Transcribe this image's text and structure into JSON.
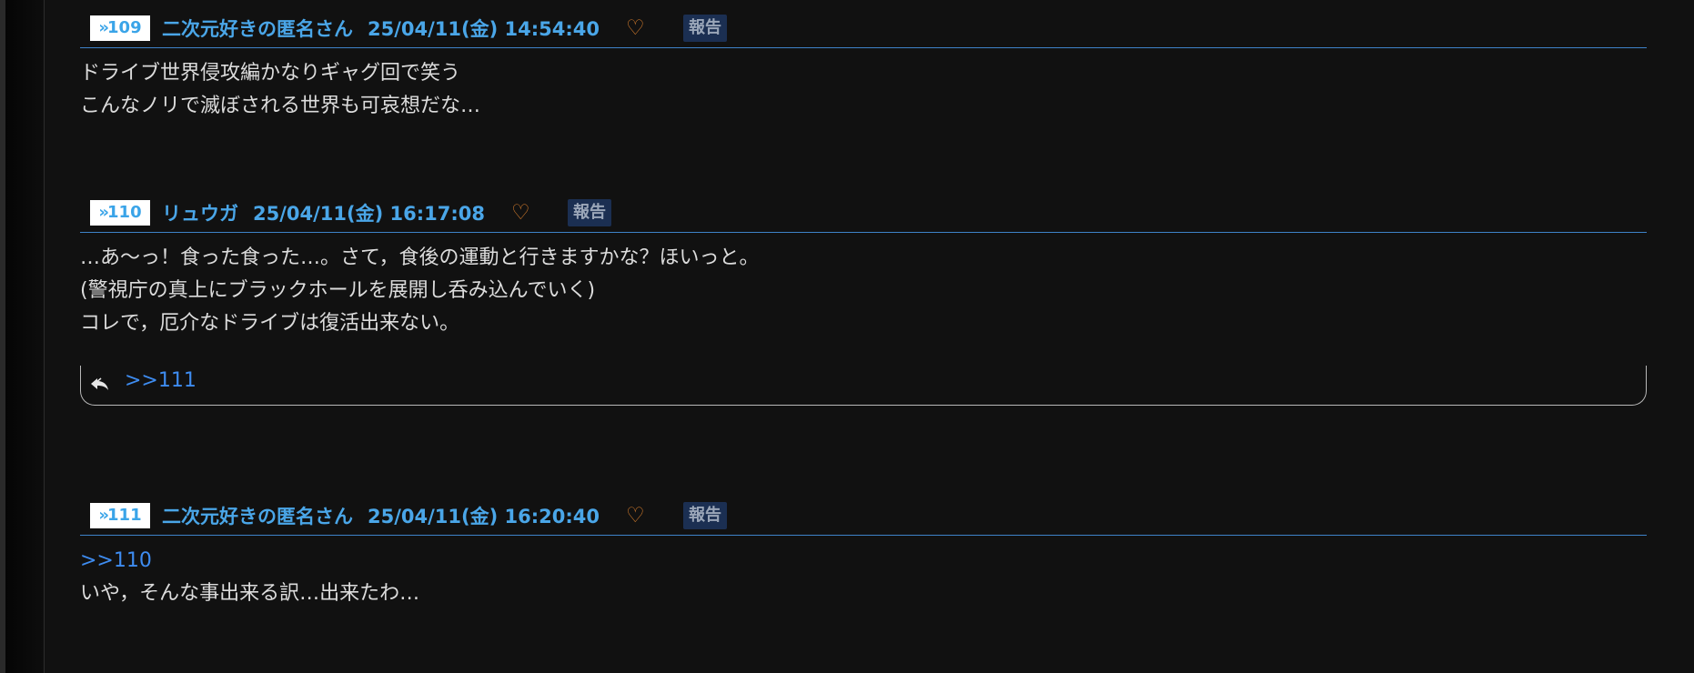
{
  "colors": {
    "background": "#111111",
    "header_text": "#4aa6e8",
    "badge_bg": "#ffffff",
    "badge_text": "#3aa4e8",
    "divider": "#3e82c8",
    "heart": "#d07a2c",
    "report_bg": "#1b2f52",
    "report_text": "#9aa6b8",
    "body_text": "#dcdcdc",
    "link": "#3e8cf0"
  },
  "posts": [
    {
      "number": "109",
      "name": "二次元好きの匿名さん",
      "date": "25/04/11(金) 14:54:40",
      "heart_icon": "heart-outline-icon",
      "report_label": "報告",
      "lines": [
        "ドライブ世界侵攻編かなりギャグ回で笑う",
        "こんなノリで滅ぼされる世界も可哀想だな…"
      ]
    },
    {
      "number": "110",
      "name": "リュウガ",
      "date": "25/04/11(金) 16:17:08",
      "heart_icon": "heart-outline-icon",
      "report_label": "報告",
      "lines": [
        "…あ〜っ！食った食った…。さて，食後の運動と行きますかな？ほいっと。",
        "(警視庁の真上にブラックホールを展開し呑み込んでいく)",
        "コレで，厄介なドライブは復活出来ない。"
      ],
      "replies": {
        "icon": "reply-arrow-icon",
        "link": ">>111"
      }
    },
    {
      "number": "111",
      "name": "二次元好きの匿名さん",
      "date": "25/04/11(金) 16:20:40",
      "heart_icon": "heart-outline-icon",
      "report_label": "報告",
      "anchor": ">>110",
      "lines": [
        "いや，そんな事出来る訳…出来たわ…"
      ]
    }
  ]
}
